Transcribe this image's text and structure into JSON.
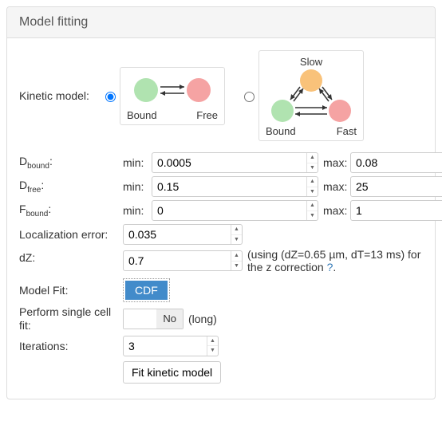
{
  "panel": {
    "title": "Model fitting"
  },
  "kinetic": {
    "label": "Kinetic model:",
    "two_state": {
      "bound": "Bound",
      "free": "Free"
    },
    "three_state": {
      "bound": "Bound",
      "fast": "Fast",
      "slow": "Slow"
    },
    "selected": "two_state"
  },
  "params": {
    "min_label": "min:",
    "max_label": "max:",
    "d_bound": {
      "label_pre": "D",
      "label_sub": "bound",
      "label_post": ":",
      "min": "0.0005",
      "max": "0.08"
    },
    "d_free": {
      "label_pre": "D",
      "label_sub": "free",
      "label_post": ":",
      "min": "0.15",
      "max": "25"
    },
    "f_bound": {
      "label_pre": "F",
      "label_sub": "bound",
      "label_post": ":",
      "min": "0",
      "max": "1"
    }
  },
  "loc_error": {
    "label": "Localization error:",
    "value": "0.035"
  },
  "dz": {
    "label": "dZ:",
    "value": "0.7",
    "note_prefix": "(using (dZ=0.65 µm, dT=13 ms) for the z correction ",
    "help": "?",
    "note_suffix": "."
  },
  "model_fit": {
    "label": "Model Fit:",
    "value": "CDF"
  },
  "single_cell": {
    "label": "Perform single cell fit:",
    "value": "No",
    "note": "(long)"
  },
  "iterations": {
    "label": "Iterations:",
    "value": "3"
  },
  "fit_button": "Fit kinetic model"
}
